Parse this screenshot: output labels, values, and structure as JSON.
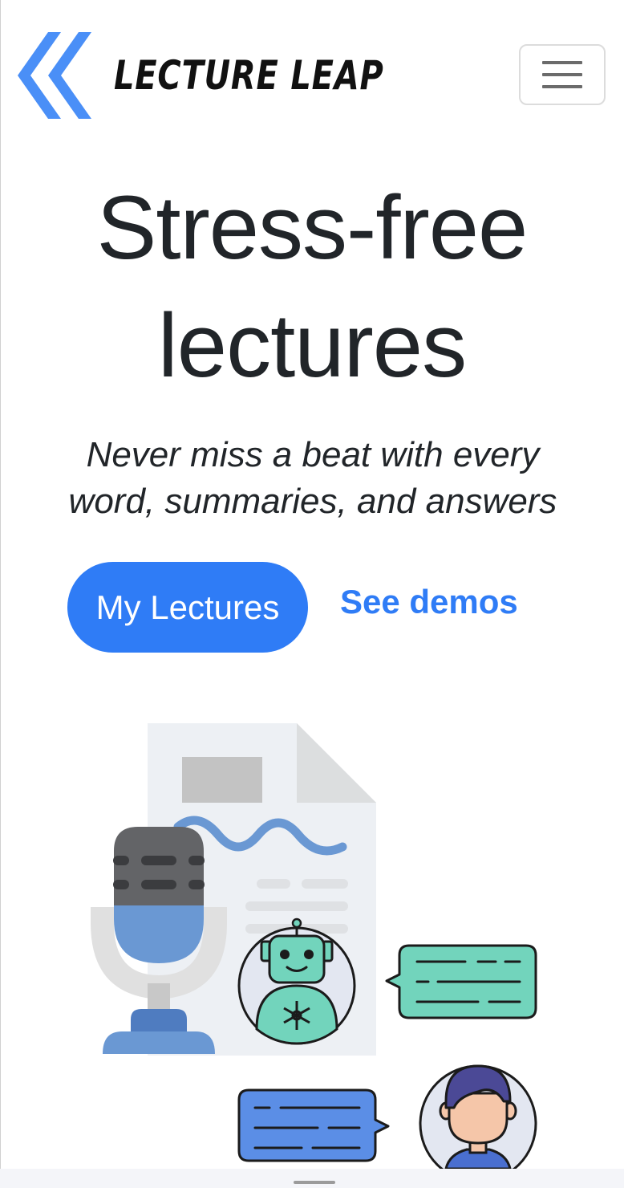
{
  "brand": {
    "name": "LECTURE LEAP",
    "logo_icon": "double-chevron-left-icon",
    "accent_color": "#4a8ff7"
  },
  "header": {
    "menu_icon": "hamburger-menu-icon"
  },
  "hero": {
    "title_line1": "Stress-free",
    "title_line2": "lectures",
    "subtitle_line1": "Never miss a beat with every",
    "subtitle_line2": "word, summaries, and answers",
    "primary_button": "My Lectures",
    "secondary_link": "See demos",
    "button_color": "#2f7cf6"
  },
  "illustration": {
    "icons": [
      "document-icon",
      "microphone-icon",
      "robot-avatar-icon",
      "ai-chat-bubble-icon",
      "user-chat-bubble-icon",
      "user-avatar-icon"
    ]
  }
}
